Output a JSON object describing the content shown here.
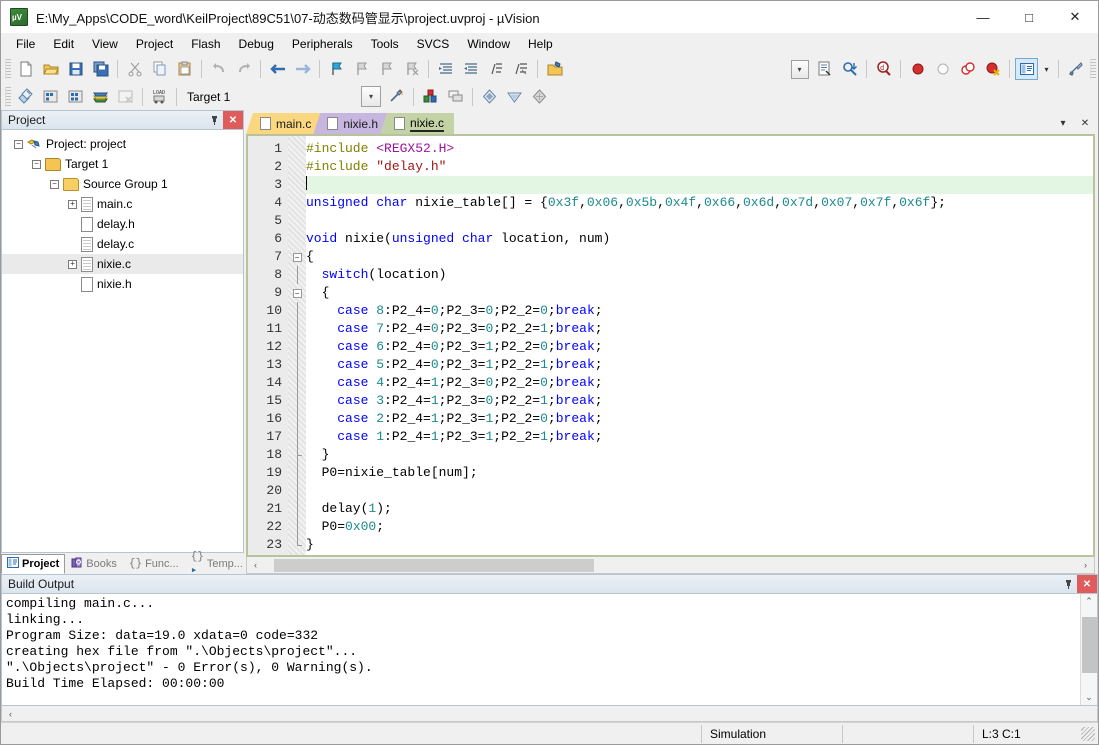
{
  "window": {
    "title": "E:\\My_Apps\\CODE_word\\KeilProject\\89C51\\07-动态数码管显示\\project.uvproj - µVision",
    "app_icon": "uvision-logo-icon",
    "minimize": "—",
    "maximize": "□",
    "close": "✕"
  },
  "menubar": {
    "items": [
      {
        "label": "File"
      },
      {
        "label": "Edit"
      },
      {
        "label": "View"
      },
      {
        "label": "Project"
      },
      {
        "label": "Flash"
      },
      {
        "label": "Debug"
      },
      {
        "label": "Peripherals"
      },
      {
        "label": "Tools"
      },
      {
        "label": "SVCS"
      },
      {
        "label": "Window"
      },
      {
        "label": "Help"
      }
    ]
  },
  "toolbar_main": {
    "buttons": [
      {
        "name": "new-file-icon",
        "tip": "New"
      },
      {
        "name": "open-file-icon",
        "tip": "Open"
      },
      {
        "name": "save-icon",
        "tip": "Save"
      },
      {
        "name": "save-all-icon",
        "tip": "Save All"
      },
      {
        "name": "cut-icon",
        "tip": "Cut"
      },
      {
        "name": "copy-icon",
        "tip": "Copy"
      },
      {
        "name": "paste-icon",
        "tip": "Paste"
      },
      {
        "name": "undo-icon",
        "tip": "Undo"
      },
      {
        "name": "redo-icon",
        "tip": "Redo"
      },
      {
        "name": "navigate-back-icon",
        "tip": "Back"
      },
      {
        "name": "navigate-forward-icon",
        "tip": "Forward"
      },
      {
        "name": "bookmark-toggle-icon",
        "tip": "Insert/Remove Bookmark"
      },
      {
        "name": "bookmark-prev-icon",
        "tip": "Previous Bookmark"
      },
      {
        "name": "bookmark-next-icon",
        "tip": "Next Bookmark"
      },
      {
        "name": "bookmark-clear-icon",
        "tip": "Clear All Bookmarks"
      },
      {
        "name": "indent-icon",
        "tip": "Indent"
      },
      {
        "name": "outdent-icon",
        "tip": "Outdent"
      },
      {
        "name": "comment-icon",
        "tip": "Comment"
      },
      {
        "name": "uncomment-icon",
        "tip": "Uncomment"
      },
      {
        "name": "open-project-folder-icon",
        "tip": "Open Folder"
      }
    ],
    "right_buttons": [
      {
        "name": "combo-dropdown-icon",
        "tip": "Find combo"
      },
      {
        "name": "file-properties-icon",
        "tip": "Configuration Wizard"
      },
      {
        "name": "find-in-files-icon",
        "tip": "Find in Files"
      },
      {
        "name": "find-icon",
        "tip": "Find"
      },
      {
        "name": "insert-breakpoint-icon",
        "tip": "Insert/Remove Breakpoint"
      },
      {
        "name": "enable-breakpoint-icon",
        "tip": "Enable/Disable Breakpoint"
      },
      {
        "name": "disable-all-breakpoints-icon",
        "tip": "Disable All Breakpoints"
      },
      {
        "name": "kill-all-breakpoints-icon",
        "tip": "Kill All Breakpoints"
      },
      {
        "name": "window-layout-icon",
        "tip": "Project Window"
      },
      {
        "name": "window-layout-dropdown-icon",
        "tip": "More"
      },
      {
        "name": "configure-icon",
        "tip": "Configure"
      }
    ]
  },
  "toolbar_build": {
    "buttons": [
      {
        "name": "translate-icon",
        "tip": "Translate"
      },
      {
        "name": "build-icon",
        "tip": "Build"
      },
      {
        "name": "rebuild-icon",
        "tip": "Rebuild"
      },
      {
        "name": "batch-build-icon",
        "tip": "Batch Build"
      },
      {
        "name": "stop-build-icon",
        "tip": "Stop Build"
      },
      {
        "name": "download-icon",
        "tip": "Download"
      }
    ],
    "target_value": "Target 1",
    "target_dropdown_icon": "chevron-down-icon",
    "after_buttons": [
      {
        "name": "target-options-icon",
        "tip": "Options for Target"
      },
      {
        "name": "manage-components-icon",
        "tip": "Manage Components"
      },
      {
        "name": "multi-project-icon",
        "tip": "Multi-Project"
      },
      {
        "name": "pack-installer-icon",
        "tip": "Pack Installer"
      },
      {
        "name": "manage-run-env-icon",
        "tip": "Manage Run-Time Environment"
      },
      {
        "name": "select-software-packs-icon",
        "tip": "Select Software Packs"
      }
    ]
  },
  "project_panel": {
    "title": "Project",
    "pin_icon": "pin-icon",
    "close_icon": "close-icon",
    "tree": [
      {
        "label": "Project: project",
        "icon": "project-icon",
        "expander": "-",
        "depth": 0,
        "selected": false
      },
      {
        "label": "Target 1",
        "icon": "target-folder-icon",
        "expander": "-",
        "depth": 1,
        "selected": false
      },
      {
        "label": "Source Group 1",
        "icon": "group-folder-icon",
        "expander": "-",
        "depth": 2,
        "selected": false
      },
      {
        "label": "main.c",
        "icon": "c-file-icon",
        "expander": "+",
        "depth": 3,
        "selected": false
      },
      {
        "label": "delay.h",
        "icon": "h-file-icon",
        "expander": "",
        "depth": 3,
        "selected": false
      },
      {
        "label": "delay.c",
        "icon": "c-file-icon",
        "expander": "",
        "depth": 3,
        "selected": false
      },
      {
        "label": "nixie.c",
        "icon": "c-file-icon",
        "expander": "+",
        "depth": 3,
        "selected": true
      },
      {
        "label": "nixie.h",
        "icon": "h-file-icon",
        "expander": "",
        "depth": 3,
        "selected": false
      }
    ],
    "tabs": [
      {
        "label": "Project",
        "icon": "project-tab-icon",
        "active": true
      },
      {
        "label": "Books",
        "icon": "books-icon",
        "active": false
      },
      {
        "label": "Func...",
        "icon": "functions-icon",
        "active": false
      },
      {
        "label": "Temp...",
        "icon": "templates-icon",
        "active": false
      }
    ]
  },
  "editor": {
    "tabs": [
      {
        "label": "main.c",
        "color": "#fbd87f",
        "active": false
      },
      {
        "label": "nixie.h",
        "color": "#c7b6e0",
        "active": false
      },
      {
        "label": "nixie.c",
        "color": "#c3d3a5",
        "active": true
      }
    ],
    "tab_dropdown_icon": "chevron-down-icon",
    "tab_close_icon": "close-icon",
    "cursor_line": 3,
    "hscroll": {
      "left_arrow": "‹",
      "right_arrow": "›"
    },
    "lines": [
      {
        "n": 1,
        "fold": "",
        "tokens": [
          {
            "t": "#include ",
            "c": "pp"
          },
          {
            "t": "<REGX52.H>",
            "c": "hdrfile"
          }
        ]
      },
      {
        "n": 2,
        "fold": "",
        "tokens": [
          {
            "t": "#include ",
            "c": "pp"
          },
          {
            "t": "\"delay.h\"",
            "c": "str"
          }
        ]
      },
      {
        "n": 3,
        "fold": "",
        "cursor": true,
        "tokens": []
      },
      {
        "n": 4,
        "fold": "",
        "tokens": [
          {
            "t": "unsigned char ",
            "c": "k"
          },
          {
            "t": "nixie_table[] = {",
            "c": "pl"
          },
          {
            "t": "0x3f",
            "c": "num"
          },
          {
            "t": ",",
            "c": "pl"
          },
          {
            "t": "0x06",
            "c": "num"
          },
          {
            "t": ",",
            "c": "pl"
          },
          {
            "t": "0x5b",
            "c": "num"
          },
          {
            "t": ",",
            "c": "pl"
          },
          {
            "t": "0x4f",
            "c": "num"
          },
          {
            "t": ",",
            "c": "pl"
          },
          {
            "t": "0x66",
            "c": "num"
          },
          {
            "t": ",",
            "c": "pl"
          },
          {
            "t": "0x6d",
            "c": "num"
          },
          {
            "t": ",",
            "c": "pl"
          },
          {
            "t": "0x7d",
            "c": "num"
          },
          {
            "t": ",",
            "c": "pl"
          },
          {
            "t": "0x07",
            "c": "num"
          },
          {
            "t": ",",
            "c": "pl"
          },
          {
            "t": "0x7f",
            "c": "num"
          },
          {
            "t": ",",
            "c": "pl"
          },
          {
            "t": "0x6f",
            "c": "num"
          },
          {
            "t": "};",
            "c": "pl"
          }
        ]
      },
      {
        "n": 5,
        "fold": "",
        "tokens": []
      },
      {
        "n": 6,
        "fold": "",
        "tokens": [
          {
            "t": "void ",
            "c": "k"
          },
          {
            "t": "nixie(",
            "c": "pl"
          },
          {
            "t": "unsigned char ",
            "c": "k"
          },
          {
            "t": "location, num)",
            "c": "pl"
          }
        ]
      },
      {
        "n": 7,
        "fold": "box",
        "tokens": [
          {
            "t": "{",
            "c": "pl"
          }
        ]
      },
      {
        "n": 8,
        "fold": "line",
        "tokens": [
          {
            "t": "  ",
            "c": "pl"
          },
          {
            "t": "switch",
            "c": "k"
          },
          {
            "t": "(location)",
            "c": "pl"
          }
        ]
      },
      {
        "n": 9,
        "fold": "box",
        "tokens": [
          {
            "t": "  {",
            "c": "pl"
          }
        ]
      },
      {
        "n": 10,
        "fold": "line",
        "tokens": [
          {
            "t": "    ",
            "c": "pl"
          },
          {
            "t": "case ",
            "c": "k"
          },
          {
            "t": "8",
            "c": "num"
          },
          {
            "t": ":P2_4=",
            "c": "pl"
          },
          {
            "t": "0",
            "c": "num"
          },
          {
            "t": ";P2_3=",
            "c": "pl"
          },
          {
            "t": "0",
            "c": "num"
          },
          {
            "t": ";P2_2=",
            "c": "pl"
          },
          {
            "t": "0",
            "c": "num"
          },
          {
            "t": ";",
            "c": "pl"
          },
          {
            "t": "break",
            "c": "k"
          },
          {
            "t": ";",
            "c": "pl"
          }
        ]
      },
      {
        "n": 11,
        "fold": "line",
        "tokens": [
          {
            "t": "    ",
            "c": "pl"
          },
          {
            "t": "case ",
            "c": "k"
          },
          {
            "t": "7",
            "c": "num"
          },
          {
            "t": ":P2_4=",
            "c": "pl"
          },
          {
            "t": "0",
            "c": "num"
          },
          {
            "t": ";P2_3=",
            "c": "pl"
          },
          {
            "t": "0",
            "c": "num"
          },
          {
            "t": ";P2_2=",
            "c": "pl"
          },
          {
            "t": "1",
            "c": "num"
          },
          {
            "t": ";",
            "c": "pl"
          },
          {
            "t": "break",
            "c": "k"
          },
          {
            "t": ";",
            "c": "pl"
          }
        ]
      },
      {
        "n": 12,
        "fold": "line",
        "tokens": [
          {
            "t": "    ",
            "c": "pl"
          },
          {
            "t": "case ",
            "c": "k"
          },
          {
            "t": "6",
            "c": "num"
          },
          {
            "t": ":P2_4=",
            "c": "pl"
          },
          {
            "t": "0",
            "c": "num"
          },
          {
            "t": ";P2_3=",
            "c": "pl"
          },
          {
            "t": "1",
            "c": "num"
          },
          {
            "t": ";P2_2=",
            "c": "pl"
          },
          {
            "t": "0",
            "c": "num"
          },
          {
            "t": ";",
            "c": "pl"
          },
          {
            "t": "break",
            "c": "k"
          },
          {
            "t": ";",
            "c": "pl"
          }
        ]
      },
      {
        "n": 13,
        "fold": "line",
        "tokens": [
          {
            "t": "    ",
            "c": "pl"
          },
          {
            "t": "case ",
            "c": "k"
          },
          {
            "t": "5",
            "c": "num"
          },
          {
            "t": ":P2_4=",
            "c": "pl"
          },
          {
            "t": "0",
            "c": "num"
          },
          {
            "t": ";P2_3=",
            "c": "pl"
          },
          {
            "t": "1",
            "c": "num"
          },
          {
            "t": ";P2_2=",
            "c": "pl"
          },
          {
            "t": "1",
            "c": "num"
          },
          {
            "t": ";",
            "c": "pl"
          },
          {
            "t": "break",
            "c": "k"
          },
          {
            "t": ";",
            "c": "pl"
          }
        ]
      },
      {
        "n": 14,
        "fold": "line",
        "tokens": [
          {
            "t": "    ",
            "c": "pl"
          },
          {
            "t": "case ",
            "c": "k"
          },
          {
            "t": "4",
            "c": "num"
          },
          {
            "t": ":P2_4=",
            "c": "pl"
          },
          {
            "t": "1",
            "c": "num"
          },
          {
            "t": ";P2_3=",
            "c": "pl"
          },
          {
            "t": "0",
            "c": "num"
          },
          {
            "t": ";P2_2=",
            "c": "pl"
          },
          {
            "t": "0",
            "c": "num"
          },
          {
            "t": ";",
            "c": "pl"
          },
          {
            "t": "break",
            "c": "k"
          },
          {
            "t": ";",
            "c": "pl"
          }
        ]
      },
      {
        "n": 15,
        "fold": "line",
        "tokens": [
          {
            "t": "    ",
            "c": "pl"
          },
          {
            "t": "case ",
            "c": "k"
          },
          {
            "t": "3",
            "c": "num"
          },
          {
            "t": ":P2_4=",
            "c": "pl"
          },
          {
            "t": "1",
            "c": "num"
          },
          {
            "t": ";P2_3=",
            "c": "pl"
          },
          {
            "t": "0",
            "c": "num"
          },
          {
            "t": ";P2_2=",
            "c": "pl"
          },
          {
            "t": "1",
            "c": "num"
          },
          {
            "t": ";",
            "c": "pl"
          },
          {
            "t": "break",
            "c": "k"
          },
          {
            "t": ";",
            "c": "pl"
          }
        ]
      },
      {
        "n": 16,
        "fold": "line",
        "tokens": [
          {
            "t": "    ",
            "c": "pl"
          },
          {
            "t": "case ",
            "c": "k"
          },
          {
            "t": "2",
            "c": "num"
          },
          {
            "t": ":P2_4=",
            "c": "pl"
          },
          {
            "t": "1",
            "c": "num"
          },
          {
            "t": ";P2_3=",
            "c": "pl"
          },
          {
            "t": "1",
            "c": "num"
          },
          {
            "t": ";P2_2=",
            "c": "pl"
          },
          {
            "t": "0",
            "c": "num"
          },
          {
            "t": ";",
            "c": "pl"
          },
          {
            "t": "break",
            "c": "k"
          },
          {
            "t": ";",
            "c": "pl"
          }
        ]
      },
      {
        "n": 17,
        "fold": "line",
        "tokens": [
          {
            "t": "    ",
            "c": "pl"
          },
          {
            "t": "case ",
            "c": "k"
          },
          {
            "t": "1",
            "c": "num"
          },
          {
            "t": ":P2_4=",
            "c": "pl"
          },
          {
            "t": "1",
            "c": "num"
          },
          {
            "t": ";P2_3=",
            "c": "pl"
          },
          {
            "t": "1",
            "c": "num"
          },
          {
            "t": ";P2_2=",
            "c": "pl"
          },
          {
            "t": "1",
            "c": "num"
          },
          {
            "t": ";",
            "c": "pl"
          },
          {
            "t": "break",
            "c": "k"
          },
          {
            "t": ";",
            "c": "pl"
          }
        ]
      },
      {
        "n": 18,
        "fold": "tick",
        "tokens": [
          {
            "t": "  }",
            "c": "pl"
          }
        ]
      },
      {
        "n": 19,
        "fold": "line",
        "tokens": [
          {
            "t": "  P0=nixie_table[num];",
            "c": "pl"
          }
        ]
      },
      {
        "n": 20,
        "fold": "line",
        "tokens": []
      },
      {
        "n": 21,
        "fold": "line",
        "tokens": [
          {
            "t": "  delay(",
            "c": "pl"
          },
          {
            "t": "1",
            "c": "num"
          },
          {
            "t": ");",
            "c": "pl"
          }
        ]
      },
      {
        "n": 22,
        "fold": "line",
        "tokens": [
          {
            "t": "  P0=",
            "c": "pl"
          },
          {
            "t": "0x00",
            "c": "num"
          },
          {
            "t": ";",
            "c": "pl"
          }
        ]
      },
      {
        "n": 23,
        "fold": "end",
        "tokens": [
          {
            "t": "}",
            "c": "pl"
          }
        ]
      }
    ]
  },
  "build_output": {
    "title": "Build Output",
    "pin_icon": "pin-icon",
    "close_icon": "close-icon",
    "lines": [
      "compiling main.c...",
      "linking...",
      "Program Size: data=19.0 xdata=0 code=332",
      "creating hex file from \".\\Objects\\project\"...",
      "\".\\Objects\\project\" - 0 Error(s), 0 Warning(s).",
      "Build Time Elapsed:  00:00:00"
    ],
    "scroll_up_icon": "chevron-up-icon",
    "scroll_down_icon": "chevron-down-icon",
    "hscroll_left_icon": "chevron-left-icon"
  },
  "statusbar": {
    "simulation": "Simulation",
    "cursor_pos": "L:3 C:1",
    "resize_grip_icon": "resize-grip-icon"
  }
}
